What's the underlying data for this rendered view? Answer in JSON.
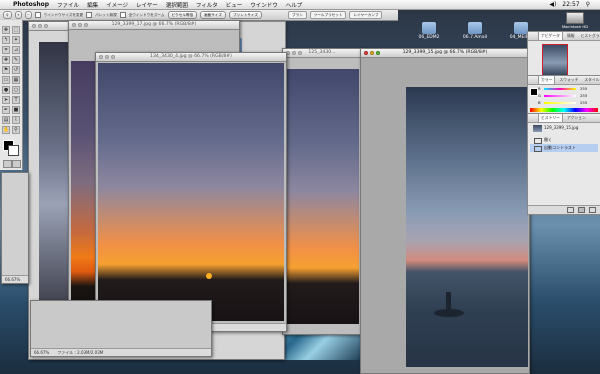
{
  "menubar": {
    "app_name": "Photoshop",
    "items": [
      "ファイル",
      "編集",
      "イメージ",
      "レイヤー",
      "選択範囲",
      "フィルタ",
      "ビュー",
      "ウインドウ",
      "ヘルプ"
    ],
    "clock": "22:57"
  },
  "options_bar": {
    "resize_windows_label": "ウインドウサイズを変更",
    "ignore_palettes_label": "パレット無視",
    "zoom_all_label": "全ウインドウをズーム",
    "actual_pixels_label": "ピクセル等倍",
    "fit_screen_label": "画面サイズ",
    "print_size_label": "プリントサイズ"
  },
  "palette_well": {
    "tabs": [
      "ブラシ",
      "ツールプリセット",
      "レイヤーカンプ"
    ]
  },
  "desktop": {
    "items": [
      "06_EDM2",
      "06.7.Amail",
      "04_MEIBO"
    ],
    "disk_label": "Macintosh HD"
  },
  "windows": [
    {
      "title": "129_3399_17.jpg @ 66.7% (RGB/8#)",
      "zoom": "66.67%",
      "file": "ファイル : 2.03M/2.03M"
    },
    {
      "title": "134_3430_4.jpg @ 66.7% (RGB/8#)",
      "zoom": "66.67%",
      "file": "ファイル : 2.03M/2.03M"
    },
    {
      "title": "129_3399_15.jpg @ 66.7% (RGB/8#)",
      "zoom": "",
      "file": ""
    },
    {
      "title": "125_3430...",
      "zoom": "66.67%",
      "file": "ファイル : 2.03M/2.03M"
    }
  ],
  "back_window": {
    "zoom": "66.67%"
  },
  "navigator": {
    "tabs": [
      "ナビゲータ",
      "情報",
      "ヒストグラム"
    ],
    "zoom": "66.67%"
  },
  "color_panel": {
    "tabs": [
      "カラー",
      "スウォッチ",
      "スタイル"
    ],
    "values": [
      "255",
      "255",
      "255"
    ],
    "labels": [
      "R",
      "G",
      "B"
    ]
  },
  "history": {
    "tabs": [
      "ヒストリー",
      "アクション"
    ],
    "snapshot": "129_3399_15.jpg",
    "steps": [
      "開く",
      "自動コントラスト"
    ]
  }
}
